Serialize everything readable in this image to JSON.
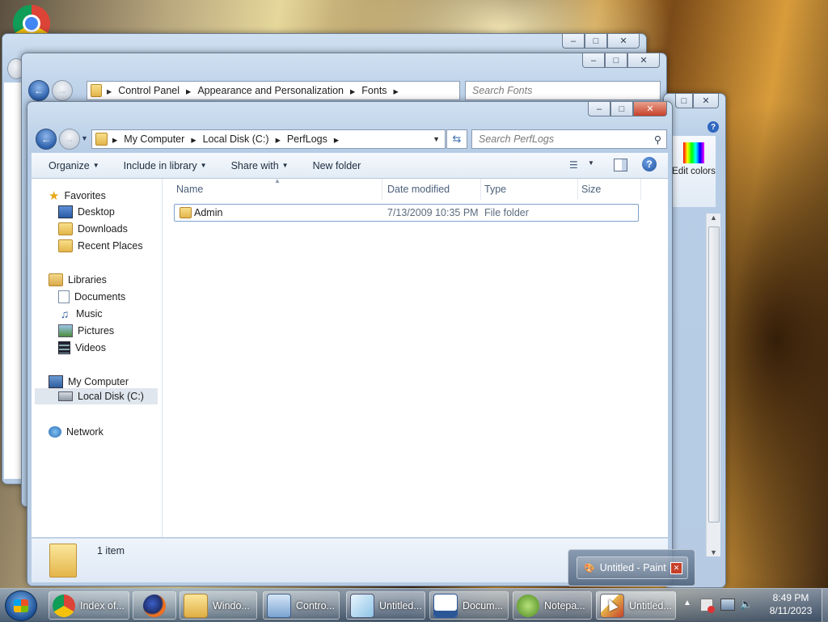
{
  "explorer": {
    "address_parts": [
      "My Computer",
      "Local Disk (C:)",
      "PerfLogs"
    ],
    "search_placeholder": "Search PerfLogs",
    "toolbar": {
      "organize": "Organize",
      "include_in_library": "Include in library",
      "share_with": "Share with",
      "new_folder": "New folder"
    },
    "nav": {
      "favorites": "Favorites",
      "desktop": "Desktop",
      "downloads": "Downloads",
      "recent_places": "Recent Places",
      "libraries": "Libraries",
      "documents": "Documents",
      "music": "Music",
      "pictures": "Pictures",
      "videos": "Videos",
      "my_computer": "My Computer",
      "local_disk": "Local Disk (C:)",
      "network": "Network"
    },
    "columns": {
      "name": "Name",
      "date_modified": "Date modified",
      "type": "Type",
      "size": "Size"
    },
    "files": [
      {
        "name": "Admin",
        "date_modified": "7/13/2009 10:35 PM",
        "type": "File folder",
        "size": ""
      }
    ],
    "status": "1 item"
  },
  "fonts_window": {
    "address_parts": [
      "Control Panel",
      "Appearance and Personalization",
      "Fonts"
    ],
    "search_placeholder": "Search Fonts"
  },
  "paint_window": {
    "edit_colors": "Edit colors"
  },
  "paint_popup": {
    "title": "Untitled - Paint"
  },
  "taskbar": {
    "buttons": [
      {
        "label": "Index of...",
        "icon": "chrome-icon"
      },
      {
        "label": "",
        "icon": "firefox-icon"
      },
      {
        "label": "Windo...",
        "icon": "explorer-icon"
      },
      {
        "label": "Contro...",
        "icon": "control-panel-icon"
      },
      {
        "label": "Untitled...",
        "icon": "notepad-icon"
      },
      {
        "label": "Docum...",
        "icon": "document-icon"
      },
      {
        "label": "Notepa...",
        "icon": "notepadpp-icon"
      },
      {
        "label": "Untitled...",
        "icon": "paint-icon"
      }
    ],
    "clock_time": "8:49 PM",
    "clock_date": "8/11/2023"
  },
  "colors": {
    "window_frame": "#b7cde6",
    "close_button": "#c7402a",
    "selection_border": "#7da2ce",
    "link_text": "#1d2d3f"
  }
}
